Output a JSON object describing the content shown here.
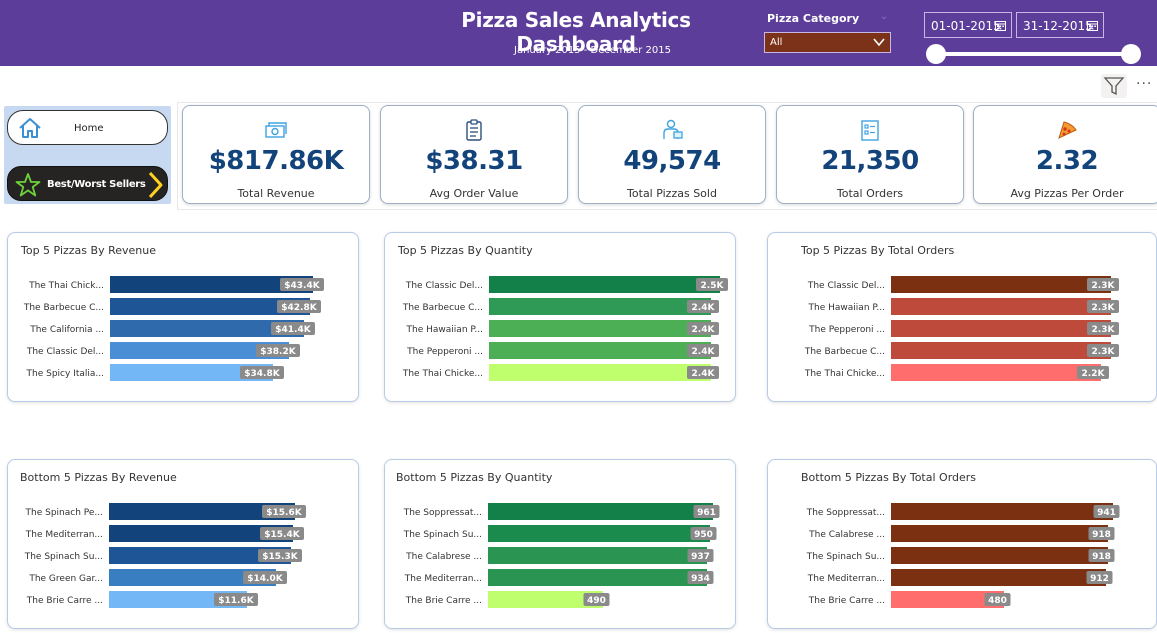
{
  "header": {
    "title": "Pizza Sales Analytics Dashboard",
    "subtitle": "January 2015 - December 2015",
    "background": "#5c3d99",
    "category_filter": {
      "label": "Pizza Category",
      "value": "All"
    },
    "date_start": "01-01-2015",
    "date_end": "31-12-2015"
  },
  "nav": {
    "home_label": "Home",
    "best_worst_label": "Best/Worst Sellers"
  },
  "kpis": [
    {
      "value": "$817.86K",
      "label": "Total Revenue",
      "icon": "money-icon"
    },
    {
      "value": "$38.31",
      "label": "Avg Order Value",
      "icon": "clipboard-icon"
    },
    {
      "value": "49,574",
      "label": "Total Pizzas Sold",
      "icon": "delivery-icon"
    },
    {
      "value": "21,350",
      "label": "Total Orders",
      "icon": "orders-icon"
    },
    {
      "value": "2.32",
      "label": "Avg Pizzas Per Order",
      "icon": "pizza-slice-icon"
    }
  ],
  "chart_data": [
    {
      "id": "top-revenue",
      "type": "bar",
      "orientation": "horizontal",
      "title": "Top 5 Pizzas By Revenue",
      "categories": [
        "The Thai Chick...",
        "The Barbecue C...",
        "The California ...",
        "The Classic Del...",
        "The Spicy Italia..."
      ],
      "values": [
        43.4,
        42.8,
        41.4,
        38.2,
        34.8
      ],
      "labels": [
        "$43.4K",
        "$42.8K",
        "$41.4K",
        "$38.2K",
        "$34.8K"
      ],
      "colors": [
        "#12437a",
        "#1e5596",
        "#2f6aad",
        "#4a8fd6",
        "#74b7f7"
      ]
    },
    {
      "id": "top-quantity",
      "type": "bar",
      "orientation": "horizontal",
      "title": "Top 5 Pizzas By Quantity",
      "categories": [
        "The Classic Del...",
        "The Barbecue C...",
        "The Hawaiian P...",
        "The Pepperoni ...",
        "The Thai Chicke..."
      ],
      "values": [
        2.5,
        2.4,
        2.4,
        2.4,
        2.4
      ],
      "labels": [
        "2.5K",
        "2.4K",
        "2.4K",
        "2.4K",
        "2.4K"
      ],
      "colors": [
        "#13804a",
        "#2f9a55",
        "#4caf56",
        "#4caf56",
        "#bfff6e"
      ]
    },
    {
      "id": "top-orders",
      "type": "bar",
      "orientation": "horizontal",
      "title": "Top 5 Pizzas By Total Orders",
      "categories": [
        "The Classic Del...",
        "The Hawaiian P...",
        "The Pepperoni ...",
        "The Barbecue C...",
        "The Thai Chicke..."
      ],
      "values": [
        2.3,
        2.3,
        2.3,
        2.3,
        2.2
      ],
      "labels": [
        "2.3K",
        "2.3K",
        "2.3K",
        "2.3K",
        "2.2K"
      ],
      "colors": [
        "#7b3012",
        "#bd4a3a",
        "#bd4a3a",
        "#bd4a3a",
        "#ff6d6d"
      ]
    },
    {
      "id": "bottom-revenue",
      "type": "bar",
      "orientation": "horizontal",
      "title": "Bottom 5 Pizzas By Revenue",
      "categories": [
        "The Spinach Pe...",
        "The Mediterran...",
        "The Spinach Su...",
        "The Green Gar...",
        "The Brie Carre ..."
      ],
      "values": [
        15.6,
        15.4,
        15.3,
        14.0,
        11.6
      ],
      "labels": [
        "$15.6K",
        "$15.4K",
        "$15.3K",
        "$14.0K",
        "$11.6K"
      ],
      "colors": [
        "#12437a",
        "#12437a",
        "#1e5596",
        "#3a7ec2",
        "#74b7f7"
      ]
    },
    {
      "id": "bottom-quantity",
      "type": "bar",
      "orientation": "horizontal",
      "title": "Bottom 5 Pizzas By Quantity",
      "categories": [
        "The Soppressat...",
        "The Spinach Su...",
        "The Calabrese ...",
        "The Mediterran...",
        "The Brie Carre ..."
      ],
      "values": [
        961,
        950,
        937,
        934,
        490
      ],
      "labels": [
        "961",
        "950",
        "937",
        "934",
        "490"
      ],
      "colors": [
        "#13804a",
        "#1a8a4d",
        "#2a9552",
        "#2a9552",
        "#bfff6e"
      ]
    },
    {
      "id": "bottom-orders",
      "type": "bar",
      "orientation": "horizontal",
      "title": "Bottom 5 Pizzas By Total Orders",
      "categories": [
        "The Soppressat...",
        "The Calabrese ...",
        "The Spinach Su...",
        "The Mediterran...",
        "The Brie Carre ..."
      ],
      "values": [
        941,
        918,
        918,
        912,
        480
      ],
      "labels": [
        "941",
        "918",
        "918",
        "912",
        "480"
      ],
      "colors": [
        "#7b3012",
        "#7b3012",
        "#7b3012",
        "#7b3012",
        "#ff6d6d"
      ]
    }
  ]
}
